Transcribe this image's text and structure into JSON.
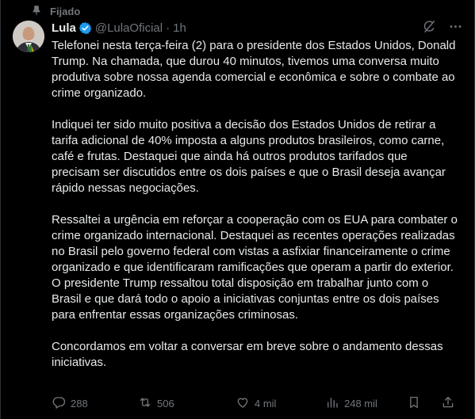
{
  "pinned": {
    "label": "Fijado",
    "icon": "pin-icon"
  },
  "author": {
    "name": "Lula",
    "handle": "@LulaOficial",
    "separator": "·",
    "time": "1h",
    "verified_color": "#1d9bf0"
  },
  "top_actions": [
    {
      "icon": "grok-icon"
    },
    {
      "icon": "more-icon"
    }
  ],
  "paragraphs": [
    "Telefonei nesta terça-feira (2) para o presidente dos Estados Unidos, Donald Trump. Na chamada, que durou 40 minutos, tivemos uma conversa muito produtiva sobre nossa agenda comercial e econômica e sobre o combate ao crime organizado.",
    "Indiquei ter sido muito positiva a decisão dos Estados Unidos de retirar a tarifa adicional de 40% imposta a alguns produtos brasileiros, como carne, café e frutas. Destaquei que ainda há outros produtos tarifados que precisam ser discutidos entre os dois países e que o Brasil deseja avançar rápido nessas negociações.",
    "Ressaltei a urgência em reforçar a cooperação com os EUA para combater o crime organizado internacional. Destaquei as recentes operações realizadas no Brasil pelo governo federal com vistas a asfixiar financeiramente o crime organizado e que identificaram ramificações que operam a partir do exterior. O presidente Trump ressaltou total disposição em trabalhar junto com o Brasil e que dará todo o apoio a iniciativas conjuntas entre os dois países para enfrentar essas organizações criminosas.",
    "Concordamos em voltar a conversar em breve sobre o andamento dessas iniciativas."
  ],
  "actions": {
    "replies": "288",
    "reposts": "506",
    "likes": "4 mil",
    "views": "248 mil"
  },
  "colors": {
    "background": "#000000",
    "text": "#e7e9ea",
    "muted": "#71767b",
    "border": "#2f3336"
  }
}
